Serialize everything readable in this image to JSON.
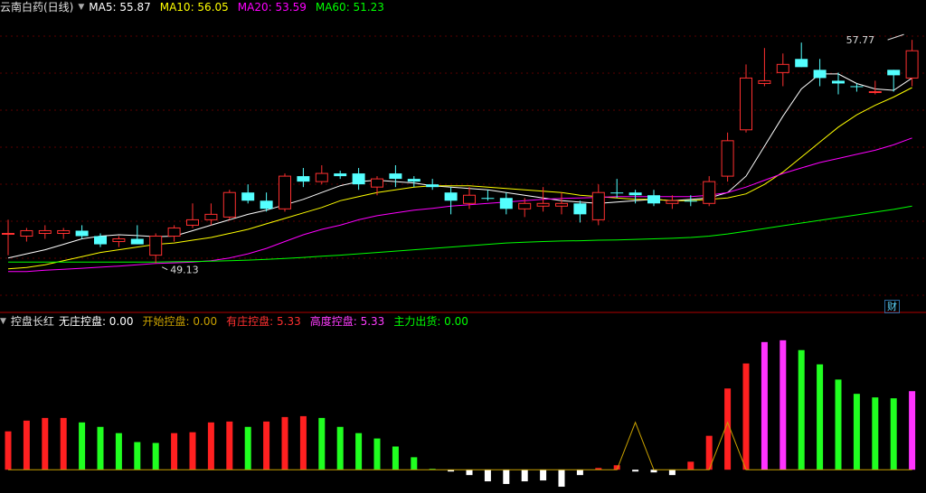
{
  "price_panel": {
    "title": "云南白药(日线)",
    "ma_labels": [
      {
        "name": "MA5",
        "value": "55.87",
        "color": "#ffffff"
      },
      {
        "name": "MA10",
        "value": "56.05",
        "color": "#ffff00"
      },
      {
        "name": "MA20",
        "value": "53.59",
        "color": "#ff00ff"
      },
      {
        "name": "MA60",
        "value": "51.23",
        "color": "#00ff00"
      }
    ],
    "high_annotation": "57.77",
    "low_annotation": "49.13",
    "badge": "财"
  },
  "indicator_panel": {
    "title": "控盘长红",
    "labels": [
      {
        "name": "无庄控盘",
        "value": "0.00",
        "color": "#ffffff"
      },
      {
        "name": "开始控盘",
        "value": "0.00",
        "color": "#c8a000"
      },
      {
        "name": "有庄控盘",
        "value": "5.33",
        "color": "#ff3030"
      },
      {
        "name": "高度控盘",
        "value": "5.33",
        "color": "#ff3cff"
      },
      {
        "name": "主力出货",
        "value": "0.00",
        "color": "#00ff00"
      }
    ]
  },
  "chart_data": [
    {
      "type": "candlestick",
      "ylim": [
        48.0,
        58.6
      ],
      "candles": [
        {
          "o": 50.7,
          "h": 51.2,
          "l": 49.9,
          "c": 50.7,
          "up": true
        },
        {
          "o": 50.6,
          "h": 50.9,
          "l": 50.4,
          "c": 50.8,
          "up": true
        },
        {
          "o": 50.7,
          "h": 51.0,
          "l": 50.5,
          "c": 50.8,
          "up": true
        },
        {
          "o": 50.7,
          "h": 50.9,
          "l": 50.5,
          "c": 50.8,
          "up": true
        },
        {
          "o": 50.8,
          "h": 51.0,
          "l": 50.5,
          "c": 50.6,
          "up": false
        },
        {
          "o": 50.6,
          "h": 50.7,
          "l": 50.2,
          "c": 50.3,
          "up": false
        },
        {
          "o": 50.4,
          "h": 50.6,
          "l": 50.2,
          "c": 50.5,
          "up": true
        },
        {
          "o": 50.5,
          "h": 51.0,
          "l": 50.3,
          "c": 50.3,
          "up": false
        },
        {
          "o": 49.9,
          "h": 50.7,
          "l": 49.6,
          "c": 50.6,
          "up": true
        },
        {
          "o": 50.6,
          "h": 51.0,
          "l": 50.4,
          "c": 50.9,
          "up": true
        },
        {
          "o": 51.0,
          "h": 51.8,
          "l": 50.9,
          "c": 51.2,
          "up": true
        },
        {
          "o": 51.2,
          "h": 51.8,
          "l": 51.0,
          "c": 51.4,
          "up": true
        },
        {
          "o": 51.3,
          "h": 52.3,
          "l": 51.2,
          "c": 52.2,
          "up": true
        },
        {
          "o": 52.2,
          "h": 52.5,
          "l": 51.8,
          "c": 51.9,
          "up": false
        },
        {
          "o": 51.9,
          "h": 52.2,
          "l": 51.5,
          "c": 51.6,
          "up": false
        },
        {
          "o": 51.6,
          "h": 52.9,
          "l": 51.5,
          "c": 52.8,
          "up": true
        },
        {
          "o": 52.8,
          "h": 53.1,
          "l": 52.4,
          "c": 52.6,
          "up": false
        },
        {
          "o": 52.6,
          "h": 53.2,
          "l": 52.5,
          "c": 52.9,
          "up": true
        },
        {
          "o": 52.9,
          "h": 53.0,
          "l": 52.7,
          "c": 52.8,
          "up": false
        },
        {
          "o": 52.9,
          "h": 53.1,
          "l": 52.3,
          "c": 52.5,
          "up": false
        },
        {
          "o": 52.4,
          "h": 52.8,
          "l": 52.1,
          "c": 52.7,
          "up": true
        },
        {
          "o": 52.9,
          "h": 53.2,
          "l": 52.4,
          "c": 52.7,
          "up": false
        },
        {
          "o": 52.7,
          "h": 52.8,
          "l": 52.4,
          "c": 52.6,
          "up": false
        },
        {
          "o": 52.5,
          "h": 52.7,
          "l": 52.3,
          "c": 52.4,
          "up": false
        },
        {
          "o": 52.2,
          "h": 52.4,
          "l": 51.4,
          "c": 51.9,
          "up": false
        },
        {
          "o": 51.8,
          "h": 52.4,
          "l": 51.6,
          "c": 52.1,
          "up": true
        },
        {
          "o": 52.0,
          "h": 52.3,
          "l": 51.9,
          "c": 52.0,
          "up": false
        },
        {
          "o": 52.0,
          "h": 52.2,
          "l": 51.4,
          "c": 51.6,
          "up": false
        },
        {
          "o": 51.6,
          "h": 52.0,
          "l": 51.3,
          "c": 51.8,
          "up": true
        },
        {
          "o": 51.7,
          "h": 52.4,
          "l": 51.5,
          "c": 51.8,
          "up": true
        },
        {
          "o": 51.7,
          "h": 52.2,
          "l": 51.4,
          "c": 51.8,
          "up": true
        },
        {
          "o": 51.8,
          "h": 51.9,
          "l": 51.1,
          "c": 51.4,
          "up": false
        },
        {
          "o": 51.2,
          "h": 52.5,
          "l": 51.0,
          "c": 52.2,
          "up": true
        },
        {
          "o": 52.2,
          "h": 52.7,
          "l": 52.0,
          "c": 52.2,
          "up": false
        },
        {
          "o": 52.2,
          "h": 52.3,
          "l": 51.8,
          "c": 52.1,
          "up": false
        },
        {
          "o": 52.1,
          "h": 52.3,
          "l": 51.7,
          "c": 51.8,
          "up": false
        },
        {
          "o": 51.8,
          "h": 52.1,
          "l": 51.6,
          "c": 51.9,
          "up": true
        },
        {
          "o": 51.9,
          "h": 52.1,
          "l": 51.7,
          "c": 51.9,
          "up": false
        },
        {
          "o": 51.8,
          "h": 52.8,
          "l": 51.7,
          "c": 52.6,
          "up": true
        },
        {
          "o": 52.8,
          "h": 54.4,
          "l": 52.6,
          "c": 54.1,
          "up": true
        },
        {
          "o": 54.5,
          "h": 56.9,
          "l": 54.4,
          "c": 56.4,
          "up": true
        },
        {
          "o": 56.2,
          "h": 57.5,
          "l": 56.1,
          "c": 56.3,
          "up": true
        },
        {
          "o": 56.6,
          "h": 57.3,
          "l": 56.1,
          "c": 56.9,
          "up": true
        },
        {
          "o": 57.1,
          "h": 57.7,
          "l": 56.8,
          "c": 56.8,
          "up": false
        },
        {
          "o": 56.7,
          "h": 57.1,
          "l": 56.1,
          "c": 56.4,
          "up": false
        },
        {
          "o": 56.3,
          "h": 56.6,
          "l": 55.8,
          "c": 56.2,
          "up": false
        },
        {
          "o": 56.1,
          "h": 56.2,
          "l": 55.9,
          "c": 56.1,
          "up": false
        },
        {
          "o": 55.9,
          "h": 56.3,
          "l": 55.8,
          "c": 55.9,
          "up": true
        },
        {
          "o": 56.5,
          "h": 56.7,
          "l": 55.9,
          "c": 56.7,
          "up": false
        },
        {
          "o": 56.4,
          "h": 57.8,
          "l": 56.1,
          "c": 57.4,
          "up": true
        }
      ],
      "ma_series": [
        {
          "name": "MA5",
          "color": "#ffffff",
          "values": [
            49.8,
            49.95,
            50.1,
            50.3,
            50.5,
            50.6,
            50.65,
            50.62,
            50.58,
            50.6,
            50.8,
            51.0,
            51.2,
            51.4,
            51.55,
            51.75,
            51.95,
            52.2,
            52.45,
            52.6,
            52.65,
            52.6,
            52.55,
            52.45,
            52.4,
            52.35,
            52.3,
            52.2,
            52.1,
            52.0,
            51.9,
            51.85,
            51.8,
            51.85,
            51.9,
            51.95,
            51.9,
            51.95,
            52.0,
            52.2,
            52.8,
            53.9,
            55.0,
            56.0,
            56.55,
            56.55,
            56.2,
            56.0,
            55.95,
            56.4
          ]
        },
        {
          "name": "MA10",
          "color": "#ffff00",
          "values": [
            49.4,
            49.45,
            49.55,
            49.7,
            49.85,
            50.0,
            50.1,
            50.2,
            50.3,
            50.35,
            50.45,
            50.55,
            50.7,
            50.85,
            51.05,
            51.25,
            51.45,
            51.65,
            51.9,
            52.05,
            52.2,
            52.3,
            52.4,
            52.45,
            52.45,
            52.45,
            52.4,
            52.35,
            52.3,
            52.25,
            52.2,
            52.1,
            52.05,
            52.0,
            51.95,
            51.95,
            51.9,
            51.9,
            51.95,
            52.0,
            52.15,
            52.5,
            52.95,
            53.5,
            54.05,
            54.6,
            55.05,
            55.4,
            55.7,
            56.05
          ]
        },
        {
          "name": "MA20",
          "color": "#ff00ff",
          "values": [
            49.3,
            49.3,
            49.35,
            49.38,
            49.42,
            49.46,
            49.5,
            49.55,
            49.6,
            49.62,
            49.65,
            49.7,
            49.8,
            49.95,
            50.15,
            50.4,
            50.65,
            50.85,
            51.0,
            51.2,
            51.35,
            51.45,
            51.55,
            51.62,
            51.7,
            51.75,
            51.8,
            51.85,
            51.9,
            51.95,
            51.98,
            52.0,
            52.02,
            52.05,
            52.05,
            52.05,
            52.05,
            52.05,
            52.1,
            52.2,
            52.4,
            52.65,
            52.9,
            53.1,
            53.3,
            53.45,
            53.6,
            53.75,
            53.95,
            54.2
          ]
        },
        {
          "name": "MA60",
          "color": "#00ff00",
          "values": [
            49.65,
            49.65,
            49.65,
            49.65,
            49.65,
            49.65,
            49.65,
            49.65,
            49.65,
            49.66,
            49.67,
            49.68,
            49.7,
            49.72,
            49.75,
            49.78,
            49.82,
            49.86,
            49.9,
            49.95,
            50.0,
            50.05,
            50.1,
            50.15,
            50.2,
            50.25,
            50.3,
            50.35,
            50.38,
            50.4,
            50.42,
            50.43,
            50.45,
            50.46,
            50.48,
            50.5,
            50.52,
            50.55,
            50.6,
            50.68,
            50.78,
            50.88,
            50.98,
            51.08,
            51.18,
            51.28,
            51.38,
            51.48,
            51.58,
            51.7
          ]
        }
      ]
    },
    {
      "type": "bar",
      "ylim": [
        -2.0,
        15.8
      ],
      "values": [
        4.3,
        5.5,
        5.8,
        5.8,
        5.3,
        4.8,
        4.1,
        3.1,
        3.0,
        4.1,
        4.2,
        5.3,
        5.4,
        4.8,
        5.4,
        5.9,
        6.0,
        5.8,
        4.8,
        4.1,
        3.5,
        2.6,
        1.4,
        0.1,
        -0.2,
        -0.6,
        -1.3,
        -1.6,
        -1.3,
        -1.2,
        -1.9,
        -0.6,
        0.2,
        0.5,
        -0.2,
        -0.3,
        -0.6,
        0.9,
        3.8,
        9.1,
        11.9,
        14.3,
        14.5,
        13.4,
        11.8,
        10.1,
        8.5,
        8.1,
        8.0,
        8.8
      ],
      "colors": [
        "red",
        "red",
        "red",
        "red",
        "green",
        "green",
        "green",
        "green",
        "green",
        "red",
        "red",
        "red",
        "red",
        "green",
        "red",
        "red",
        "red",
        "green",
        "green",
        "green",
        "green",
        "green",
        "green",
        "green",
        "white",
        "white",
        "white",
        "white",
        "white",
        "white",
        "white",
        "white",
        "red",
        "red",
        "white",
        "white",
        "white",
        "red",
        "red",
        "red",
        "red",
        "magenta",
        "magenta",
        "green",
        "green",
        "green",
        "green",
        "green",
        "green",
        "magenta"
      ],
      "line_values": [
        0,
        0,
        0,
        0,
        0,
        0,
        0,
        0,
        0,
        0,
        0,
        0,
        0,
        0,
        0,
        0,
        0,
        0,
        0,
        0,
        0,
        0,
        0,
        0,
        0,
        0,
        0,
        0,
        0,
        0,
        0,
        0,
        0,
        0,
        5.3,
        0,
        0,
        0,
        0,
        5.3,
        0,
        0,
        0,
        0,
        0,
        0,
        0,
        0,
        0,
        0
      ],
      "line_color": "#c8a000"
    }
  ]
}
